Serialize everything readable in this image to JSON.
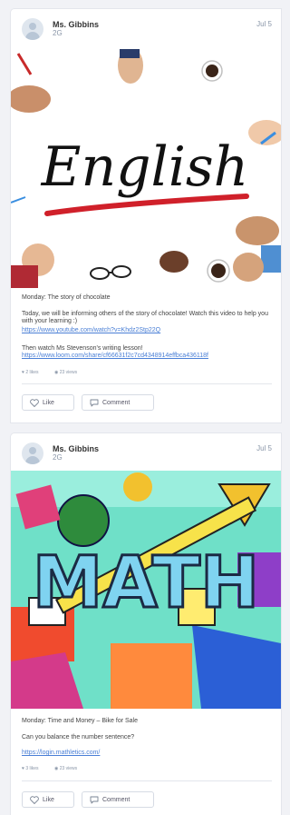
{
  "posts": [
    {
      "author": "Ms. Gibbins",
      "class": "2G",
      "date": "Jul 5",
      "title": "Monday: The story of chocolate",
      "body": "Today, we will be informing others of the story of chocolate! Watch this video to help you with your learning :)",
      "link1": "https://www.youtube.com/watch?v=Khdz2Stp22Q",
      "body2": "Then watch Ms Stevenson's writing lesson!",
      "link2": "https://www.loom.com/share/cf66631f2c7cd4348914effbca436118f",
      "likes": "2 likes",
      "views": "23 views",
      "like_label": "Like",
      "comment_label": "Comment",
      "image_text": "English"
    },
    {
      "author": "Ms. Gibbins",
      "class": "2G",
      "date": "Jul 5",
      "title": "Monday: Time and Money – Bike for Sale",
      "body": "Can you balance the number sentence?",
      "link1": "https://login.mathletics.com/",
      "likes": "3 likes",
      "views": "23 views",
      "like_label": "Like",
      "comment_label": "Comment",
      "image_text": "MATH"
    }
  ],
  "colors": {
    "accent_link": "#4a7fd6",
    "meta_text": "#8a96a8",
    "page_bg": "#f1f2f6"
  }
}
